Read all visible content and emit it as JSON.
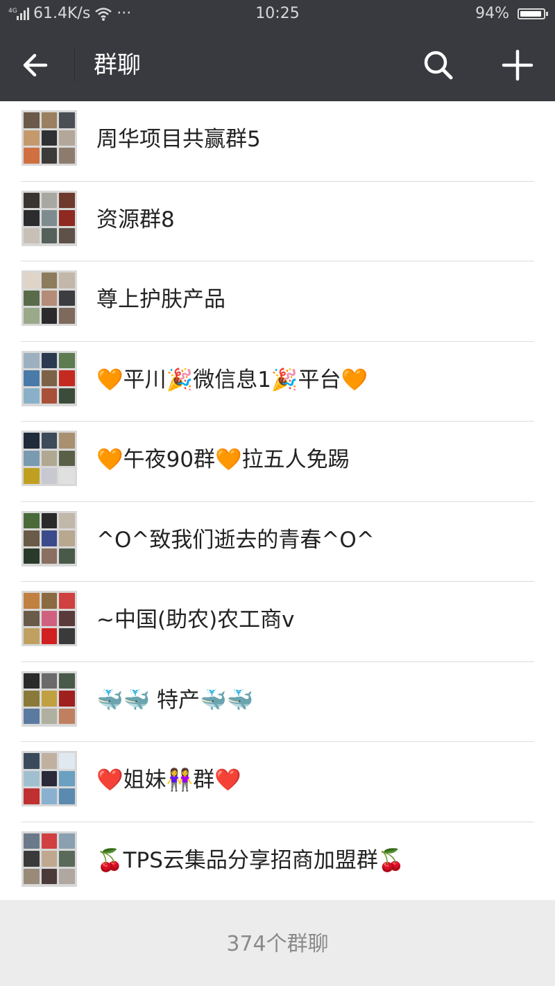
{
  "status_bar": {
    "network": "4G",
    "speed": "61.4K/s",
    "more": "···",
    "time": "10:25",
    "battery_percent_text": "94%",
    "battery_level": 0.94
  },
  "header": {
    "title": "群聊",
    "back_icon": "arrow-left-icon",
    "search_icon": "search-icon",
    "add_icon": "plus-icon"
  },
  "groups": [
    {
      "name": "周华项目共赢群5",
      "avatar_colors": [
        "#6b5a4a",
        "#9a8060",
        "#4a4f55",
        "#c49a6c",
        "#2f3033",
        "#b3a79a",
        "#d07040",
        "#3d3b3a",
        "#8d7c6e"
      ]
    },
    {
      "name": "资源群8",
      "avatar_colors": [
        "#3b3532",
        "#a9a7a2",
        "#6e3a2e",
        "#2a2c2e",
        "#7f8c8f",
        "#8e2a22",
        "#c8c0b6",
        "#55605a",
        "#5e5147"
      ]
    },
    {
      "name": "尊上护肤产品",
      "avatar_colors": [
        "#e0d4c8",
        "#8c7b5c",
        "#c2b7a8",
        "#5a6b4a",
        "#b58c78",
        "#3c3d40",
        "#9aa98a",
        "#2b2a2c",
        "#7d6a5c"
      ]
    },
    {
      "name": "🧡平川🎉微信息1🎉平台🧡",
      "avatar_colors": [
        "#9cb0c0",
        "#2c3a50",
        "#5e7a50",
        "#4a7aa8",
        "#7d6248",
        "#c42a20",
        "#8ab0c8",
        "#a85038",
        "#3c4c3a"
      ]
    },
    {
      "name": "🧡午夜90群🧡拉五人免踢",
      "avatar_colors": [
        "#1f2a3a",
        "#3c4a5a",
        "#a89070",
        "#7a9ab0",
        "#b0a890",
        "#5a6048",
        "#c0a020",
        "#c8c8d0",
        "#e0e0e0"
      ]
    },
    {
      "name": "^O^致我们逝去的青春^O^",
      "avatar_colors": [
        "#4a6a3a",
        "#2a2a2a",
        "#c0b8a8",
        "#6a5a48",
        "#3a4a8a",
        "#b8a890",
        "#2a3a2a",
        "#8a7060",
        "#4a5a4a"
      ]
    },
    {
      "name": "~中国(助农)农工商v",
      "avatar_colors": [
        "#c08040",
        "#8a6a40",
        "#d04040",
        "#6a5a4a",
        "#d06080",
        "#5a3a3a",
        "#c0a060",
        "#d02020",
        "#3a3a3a"
      ]
    },
    {
      "name": "🐳🐳   特产🐳🐳",
      "avatar_colors": [
        "#2a2a2a",
        "#6a6a6a",
        "#4a5a4a",
        "#8a7a3a",
        "#c0a040",
        "#a02020",
        "#5a7aa0",
        "#b0b0a0",
        "#c08060"
      ]
    },
    {
      "name": "❤️姐妹👭群❤️",
      "avatar_colors": [
        "#3a4a5a",
        "#c0b0a0",
        "#e0e8f0",
        "#a0c0d0",
        "#2a2a3a",
        "#6aa0c0",
        "#c03030",
        "#8ab0d0",
        "#5a8ab0"
      ]
    },
    {
      "name": "🍒TPS云集品分享招商加盟群🍒",
      "avatar_colors": [
        "#6a7a8a",
        "#d04040",
        "#8aa0b0",
        "#3a3a3a",
        "#c0a890",
        "#5a6a5a",
        "#9a8a7a",
        "#4a3a3a",
        "#b0a8a0"
      ]
    }
  ],
  "footer": {
    "count_text": "374个群聊"
  }
}
